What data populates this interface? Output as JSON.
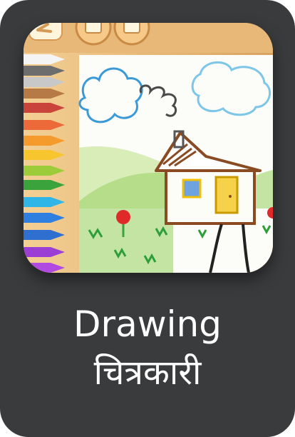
{
  "app": {
    "title_en": "Drawing",
    "title_hi": "चित्रकारी",
    "icon": "drawing-app-icon"
  },
  "colors": {
    "tile_background": "#3a3b3d",
    "label_text": "#ffffff",
    "crayons": [
      "#f4f4f4",
      "#6d6d6d",
      "#c8c8c8",
      "#b57a45",
      "#c9443a",
      "#ec6a3a",
      "#f59a2c",
      "#f7c62e",
      "#9ccc3a",
      "#3aa33b",
      "#2fb5e6",
      "#2f7fe0",
      "#9b3fd4"
    ]
  }
}
